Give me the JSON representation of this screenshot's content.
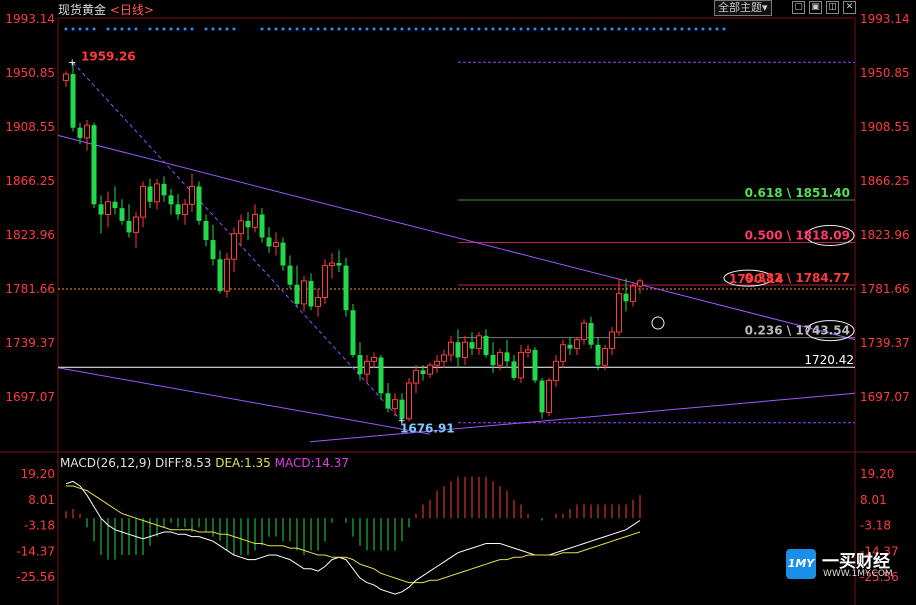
{
  "header": {
    "instrument": "现货黄金",
    "timeframe": "<日线>"
  },
  "toolbar": {
    "theme_button": "全部主题",
    "icons": [
      "dropdown-icon",
      "window-icon",
      "window-icon",
      "close-icon"
    ]
  },
  "colors": {
    "up": "#ff3b3b",
    "down": "#22d94a",
    "axis_text": "#ff3b3b",
    "fib_line": "#dd2255",
    "channel": "#9b59ff"
  },
  "chart_data": [
    {
      "type": "candlestick",
      "ylim": [
        1660,
        1995
      ],
      "y_ticks": [
        1993.14,
        1950.85,
        1908.55,
        1866.25,
        1823.96,
        1781.66,
        1739.37,
        1697.07
      ],
      "x": [
        "1",
        "2",
        "3",
        "4",
        "5",
        "6",
        "7",
        "8",
        "9",
        "10",
        "11",
        "12",
        "13",
        "14",
        "15",
        "16",
        "17",
        "18",
        "19",
        "20",
        "21",
        "22",
        "23",
        "24",
        "25",
        "26",
        "27",
        "28",
        "29",
        "30",
        "31",
        "32",
        "33",
        "34",
        "35",
        "36",
        "37",
        "38",
        "39",
        "40",
        "41",
        "42",
        "43",
        "44",
        "45",
        "46",
        "47",
        "48",
        "49",
        "50",
        "51",
        "52",
        "53",
        "54",
        "55",
        "56",
        "57",
        "58",
        "59",
        "60",
        "61",
        "62",
        "63",
        "64",
        "65",
        "66",
        "67",
        "68",
        "69",
        "70",
        "71",
        "72",
        "73",
        "74",
        "75",
        "76",
        "77",
        "78",
        "79",
        "80",
        "81",
        "82",
        "83",
        "84",
        "85",
        "86",
        "87",
        "88",
        "89",
        "90",
        "91",
        "92",
        "93",
        "94",
        "95"
      ],
      "ohlc": [
        [
          1945,
          1952,
          1940,
          1950
        ],
        [
          1950,
          1959.26,
          1905,
          1908
        ],
        [
          1908,
          1912,
          1895,
          1900
        ],
        [
          1900,
          1914,
          1890,
          1910
        ],
        [
          1910,
          1912,
          1845,
          1848
        ],
        [
          1848,
          1855,
          1825,
          1840
        ],
        [
          1840,
          1858,
          1830,
          1850
        ],
        [
          1850,
          1862,
          1840,
          1845
        ],
        [
          1845,
          1852,
          1832,
          1835
        ],
        [
          1835,
          1848,
          1822,
          1826
        ],
        [
          1826,
          1842,
          1814,
          1838
        ],
        [
          1838,
          1866,
          1830,
          1862
        ],
        [
          1862,
          1868,
          1845,
          1850
        ],
        [
          1850,
          1868,
          1844,
          1864
        ],
        [
          1864,
          1870,
          1850,
          1855
        ],
        [
          1855,
          1860,
          1840,
          1848
        ],
        [
          1848,
          1856,
          1836,
          1840
        ],
        [
          1840,
          1852,
          1832,
          1848
        ],
        [
          1848,
          1872,
          1842,
          1862
        ],
        [
          1862,
          1866,
          1832,
          1835
        ],
        [
          1835,
          1840,
          1815,
          1820
        ],
        [
          1820,
          1832,
          1800,
          1805
        ],
        [
          1805,
          1812,
          1778,
          1780
        ],
        [
          1780,
          1810,
          1775,
          1805
        ],
        [
          1805,
          1830,
          1795,
          1825
        ],
        [
          1825,
          1840,
          1815,
          1835
        ],
        [
          1835,
          1842,
          1820,
          1830
        ],
        [
          1830,
          1848,
          1826,
          1840
        ],
        [
          1840,
          1845,
          1818,
          1822
        ],
        [
          1822,
          1830,
          1810,
          1815
        ],
        [
          1815,
          1826,
          1808,
          1818
        ],
        [
          1818,
          1822,
          1796,
          1800
        ],
        [
          1800,
          1808,
          1782,
          1785
        ],
        [
          1785,
          1800,
          1768,
          1770
        ],
        [
          1770,
          1792,
          1764,
          1788
        ],
        [
          1788,
          1794,
          1765,
          1768
        ],
        [
          1768,
          1782,
          1760,
          1775
        ],
        [
          1775,
          1805,
          1770,
          1800
        ],
        [
          1800,
          1810,
          1790,
          1802
        ],
        [
          1802,
          1812,
          1795,
          1800
        ],
        [
          1800,
          1806,
          1760,
          1765
        ],
        [
          1765,
          1770,
          1728,
          1730
        ],
        [
          1730,
          1740,
          1710,
          1715
        ],
        [
          1715,
          1730,
          1708,
          1725
        ],
        [
          1725,
          1732,
          1720,
          1728
        ],
        [
          1728,
          1730,
          1695,
          1700
        ],
        [
          1700,
          1708,
          1685,
          1688
        ],
        [
          1688,
          1700,
          1682,
          1695
        ],
        [
          1695,
          1700,
          1676.91,
          1680
        ],
        [
          1680,
          1712,
          1678,
          1708
        ],
        [
          1708,
          1722,
          1700,
          1718
        ],
        [
          1718,
          1722,
          1710,
          1715
        ],
        [
          1715,
          1724,
          1712,
          1722
        ],
        [
          1722,
          1730,
          1716,
          1725
        ],
        [
          1725,
          1734,
          1720,
          1730
        ],
        [
          1730,
          1745,
          1725,
          1740
        ],
        [
          1740,
          1750,
          1720,
          1728
        ],
        [
          1728,
          1745,
          1722,
          1740
        ],
        [
          1740,
          1748,
          1730,
          1735
        ],
        [
          1735,
          1748,
          1730,
          1745
        ],
        [
          1745,
          1750,
          1728,
          1730
        ],
        [
          1730,
          1740,
          1716,
          1722
        ],
        [
          1722,
          1735,
          1718,
          1732
        ],
        [
          1732,
          1742,
          1720,
          1725
        ],
        [
          1725,
          1730,
          1710,
          1712
        ],
        [
          1712,
          1738,
          1708,
          1732
        ],
        [
          1732,
          1738,
          1728,
          1734
        ],
        [
          1734,
          1736,
          1708,
          1710
        ],
        [
          1710,
          1712,
          1680,
          1685
        ],
        [
          1685,
          1712,
          1682,
          1710
        ],
        [
          1710,
          1730,
          1705,
          1725
        ],
        [
          1725,
          1742,
          1720,
          1738
        ],
        [
          1738,
          1744,
          1730,
          1735
        ],
        [
          1735,
          1744,
          1730,
          1742
        ],
        [
          1742,
          1758,
          1738,
          1755
        ],
        [
          1755,
          1760,
          1735,
          1738
        ],
        [
          1738,
          1744,
          1718,
          1722
        ],
        [
          1722,
          1738,
          1718,
          1735
        ],
        [
          1735,
          1752,
          1730,
          1748
        ],
        [
          1748,
          1790.14,
          1745,
          1778
        ],
        [
          1778,
          1790,
          1764,
          1772
        ],
        [
          1772,
          1786,
          1768,
          1784
        ],
        [
          1784,
          1790,
          1778,
          1788
        ]
      ],
      "labels": [
        {
          "text": "1959.26",
          "value": 1959.26,
          "kind": "high"
        },
        {
          "text": "1676.91",
          "value": 1676.91,
          "kind": "low"
        },
        {
          "text": "1790.14",
          "value": 1790.14,
          "kind": "high"
        },
        {
          "text": "1720.42",
          "value": 1720.42,
          "kind": "level"
        }
      ],
      "fib_levels": [
        {
          "ratio": "0.618",
          "value": "1851.40",
          "text": "0.618 \\ 1851.40"
        },
        {
          "ratio": "0.500",
          "value": "1818.09",
          "text": "0.500 \\ 1818.09"
        },
        {
          "ratio": "0.382",
          "value": "1784.77",
          "text": "0.382 \\ 1784.77"
        },
        {
          "ratio": "0.236",
          "value": "1743.54",
          "text": "0.236 \\ 1743.54"
        }
      ],
      "reference_lines": [
        1781.66
      ]
    },
    {
      "type": "macd",
      "title": "MACD(26,12,9)",
      "stats": [
        {
          "label": "DIFF:",
          "value": "8.53"
        },
        {
          "label": "DEA:",
          "value": "1.35"
        },
        {
          "label": "MACD:",
          "value": "14.37"
        }
      ],
      "ylim": [
        -33,
        25
      ],
      "y_ticks": [
        19.2,
        8.01,
        -3.18,
        -14.37,
        -25.56
      ],
      "diff": [
        15,
        16,
        14,
        10,
        5,
        0,
        -3,
        -5,
        -6,
        -7,
        -8,
        -9,
        -8,
        -7,
        -6,
        -6,
        -7,
        -7,
        -8,
        -8,
        -9,
        -10,
        -12,
        -14,
        -16,
        -17,
        -18,
        -18,
        -17,
        -16,
        -16,
        -17,
        -18,
        -20,
        -22,
        -22,
        -23,
        -21,
        -18,
        -17,
        -18,
        -22,
        -26,
        -28,
        -29,
        -31,
        -32,
        -33,
        -32,
        -30,
        -27,
        -25,
        -23,
        -21,
        -19,
        -17,
        -15,
        -14,
        -13,
        -12,
        -11,
        -11,
        -11,
        -12,
        -13,
        -14,
        -15,
        -16,
        -16,
        -16,
        -15,
        -14,
        -13,
        -12,
        -11,
        -10,
        -9,
        -8,
        -7,
        -6,
        -5,
        -3,
        -1,
        2,
        4,
        6,
        8.53,
        8,
        8,
        8
      ],
      "dea": [
        14,
        14,
        13,
        12,
        10,
        8,
        6,
        4,
        2,
        1,
        0,
        -1,
        -2,
        -3,
        -4,
        -5,
        -5,
        -5,
        -5,
        -6,
        -6,
        -6,
        -7,
        -7,
        -8,
        -9,
        -10,
        -11,
        -11,
        -12,
        -12,
        -12,
        -13,
        -13,
        -14,
        -15,
        -16,
        -16,
        -17,
        -17,
        -17,
        -18,
        -20,
        -21,
        -22,
        -24,
        -25,
        -26,
        -27,
        -28,
        -28,
        -28,
        -27,
        -27,
        -26,
        -25,
        -24,
        -23,
        -22,
        -21,
        -20,
        -19,
        -18,
        -18,
        -17,
        -17,
        -16,
        -16,
        -16,
        -16,
        -16,
        -15,
        -15,
        -15,
        -14,
        -13,
        -12,
        -11,
        -10,
        -9,
        -8,
        -7,
        -6,
        -5,
        -4,
        -3,
        -2,
        -1,
        1.35,
        2
      ],
      "macd": [
        3,
        4,
        2,
        -4,
        -10,
        -16,
        -18,
        -18,
        -16,
        -16,
        -16,
        -16,
        -12,
        -8,
        -4,
        -2,
        -4,
        -4,
        -6,
        -4,
        -6,
        -8,
        -10,
        -14,
        -16,
        -16,
        -16,
        -14,
        -12,
        -8,
        -8,
        -10,
        -10,
        -14,
        -16,
        -14,
        -14,
        -10,
        -2,
        0,
        -2,
        -8,
        -12,
        -14,
        -14,
        -14,
        -14,
        -14,
        -10,
        -4,
        2,
        6,
        8,
        12,
        14,
        16,
        18,
        18,
        18,
        18,
        18,
        16,
        14,
        12,
        8,
        6,
        2,
        0,
        -1,
        0,
        2,
        2,
        4,
        6,
        6,
        6,
        6,
        6,
        6,
        6,
        6,
        8,
        10,
        12,
        14,
        14,
        14,
        14,
        14.37,
        14
      ]
    }
  ],
  "watermark": {
    "brand_cn": "一买财经",
    "brand_en": "WWW.1MY.COM",
    "logo_text": "1MY"
  }
}
